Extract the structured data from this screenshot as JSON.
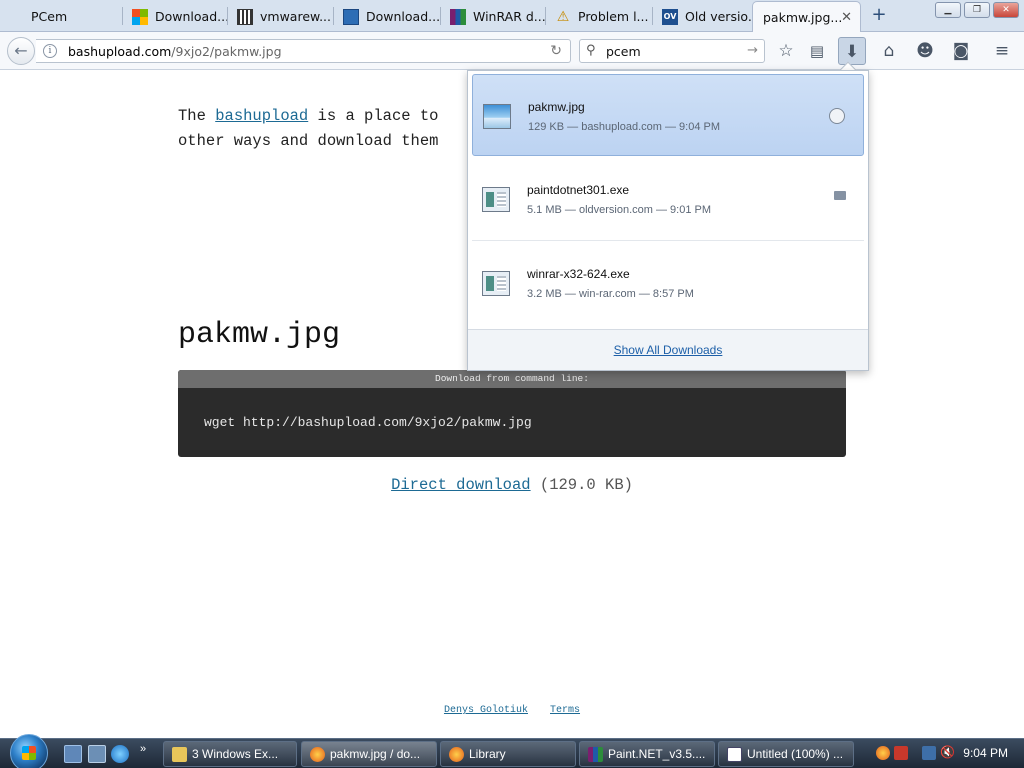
{
  "browser": {
    "tabs": [
      {
        "title": "PCem",
        "icon": "blank-page-icon"
      },
      {
        "title": "Download...",
        "icon": "microsoft-icon"
      },
      {
        "title": "vmwarew...",
        "icon": "library-icon"
      },
      {
        "title": "Download...",
        "icon": "blue-page-icon"
      },
      {
        "title": "WinRAR d...",
        "icon": "winrar-icon"
      },
      {
        "title": "Problem l...",
        "icon": "warning-icon"
      },
      {
        "title": "Old versio...",
        "icon": "ov-icon"
      },
      {
        "title": "pakmw.jpg...",
        "icon": "none"
      }
    ],
    "ov_badge": "OV",
    "new_tab_symbol": "+",
    "url_host": "bashupload.com",
    "url_path": "/9xjo2/pakmw.jpg",
    "search_text": "pcem"
  },
  "page": {
    "intro_prefix": "The",
    "intro_link": "bashupload",
    "intro_line1_rest": "is a place to",
    "intro_line2": "other ways and download them",
    "file_title": "pakmw.jpg",
    "cmd_header": "Download from command line:",
    "cmd_text": "wget http://bashupload.com/9xjo2/pakmw.jpg",
    "direct_link": "Direct download",
    "direct_size": "(129.0 KB)",
    "footer_links": [
      "Denys Golotiuk",
      "Terms"
    ]
  },
  "downloads_panel": {
    "items": [
      {
        "name": "pakmw.jpg",
        "meta": "129 KB — bashupload.com — 9:04 PM",
        "type": "image"
      },
      {
        "name": "paintdotnet301.exe",
        "meta": "5.1 MB — oldversion.com — 9:01 PM",
        "type": "exe"
      },
      {
        "name": "winrar-x32-624.exe",
        "meta": "3.2 MB — win-rar.com — 8:57 PM",
        "type": "exe"
      }
    ],
    "show_all": "Show All Downloads"
  },
  "taskbar": {
    "buttons": [
      {
        "label": "3 Windows Ex...",
        "icon": "folder-icon"
      },
      {
        "label": "pakmw.jpg / do...",
        "icon": "firefox-icon"
      },
      {
        "label": "Library",
        "icon": "firefox-icon"
      },
      {
        "label": "Paint.NET_v3.5....",
        "icon": "winrar-icon"
      },
      {
        "label": "Untitled (100%) ...",
        "icon": "paint-icon"
      }
    ],
    "clock": "9:04 PM"
  },
  "colors": {
    "link": "#1d6a94",
    "tabstrip": "#d7e2ef",
    "selected_download": "#c5d9f4",
    "cmd_background": "#2b2b2b"
  }
}
